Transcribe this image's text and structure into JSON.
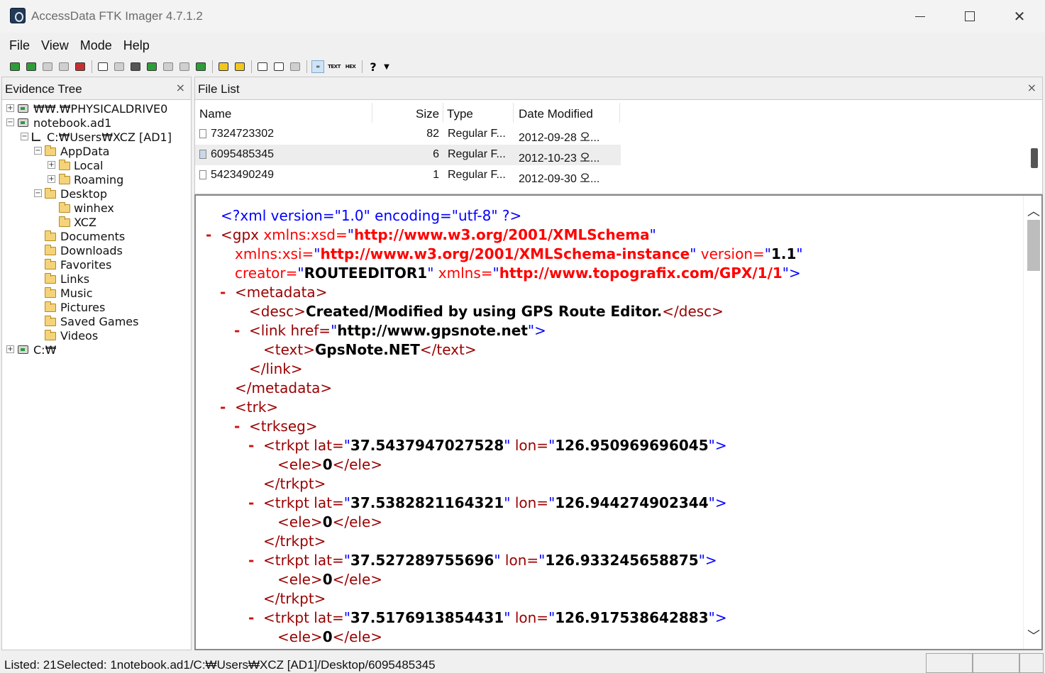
{
  "window": {
    "title": "AccessData FTK Imager 4.7.1.2"
  },
  "menu": [
    "File",
    "View",
    "Mode",
    "Help"
  ],
  "toolbar_icons": [
    "add-evidence-icon",
    "add-all-icon",
    "image-mounting-icon",
    "remove-evidence-icon",
    "remove-all-icon",
    "create-image-icon",
    "export-image-icon",
    "export-logical-icon",
    "export-files-icon",
    "export-hash-icon",
    "verify-drive-icon",
    "capture-memory-icon",
    "obtain-protected-files-icon",
    "detect-encryption-icon",
    "view-files-icon",
    "view-properties-icon",
    "view-report-icon",
    "auto-mode-icon",
    "text-mode-icon",
    "hex-mode-icon",
    "help-icon"
  ],
  "evidence_tree": {
    "title": "Evidence Tree",
    "close": "×",
    "items": [
      {
        "label": "₩₩.₩PHYSICALDRIVE0",
        "expander": "+"
      },
      {
        "label": "notebook.ad1",
        "expander": "−"
      },
      {
        "label": "C:₩Users₩XCZ [AD1]",
        "expander": "−"
      },
      {
        "label": "AppData",
        "expander": "−"
      },
      {
        "label": "Local",
        "expander": "+"
      },
      {
        "label": "Roaming",
        "expander": "+"
      },
      {
        "label": "Desktop",
        "expander": "−"
      },
      {
        "label": "winhex",
        "expander": ""
      },
      {
        "label": "XCZ",
        "expander": ""
      },
      {
        "label": "Documents",
        "expander": ""
      },
      {
        "label": "Downloads",
        "expander": ""
      },
      {
        "label": "Favorites",
        "expander": ""
      },
      {
        "label": "Links",
        "expander": ""
      },
      {
        "label": "Music",
        "expander": ""
      },
      {
        "label": "Pictures",
        "expander": ""
      },
      {
        "label": "Saved Games",
        "expander": ""
      },
      {
        "label": "Videos",
        "expander": ""
      },
      {
        "label": "C:₩",
        "expander": "+"
      }
    ]
  },
  "file_list": {
    "title": "File List",
    "close": "×",
    "columns": [
      "Name",
      "Size",
      "Type",
      "Date Modified"
    ],
    "rows": [
      {
        "name": "7324723302",
        "size": "82",
        "type": "Regular F...",
        "date": "2012-09-28 오..."
      },
      {
        "name": "6095485345",
        "size": "6",
        "type": "Regular F...",
        "date": "2012-10-23 오..."
      },
      {
        "name": "5423490249",
        "size": "1",
        "type": "Regular F...",
        "date": "2012-09-30 오..."
      }
    ]
  },
  "xml": {
    "minus": "-",
    "l1": {
      "pre": "<?xml version=\"1.0\" encoding=\"utf-8\" ?>"
    },
    "l2": {
      "open": "<gpx",
      "attr1": " xmlns:xsd=",
      "q": "\"",
      "v1": "http://www.w3.org/2001/XMLSchema"
    },
    "l3": {
      "attr2": "xmlns:xsi=",
      "v2": "http://www.w3.org/2001/XMLSchema-instance",
      "attr3": " version=",
      "v3": "1.1"
    },
    "l4": {
      "attr4": "creator=",
      "v4": "ROUTEEDITOR1",
      "attr5": " xmlns=",
      "v5": "http://www.topografix.com/GPX/1/1",
      "close": ">"
    },
    "metadata_open": "<metadata>",
    "desc_open": "<desc>",
    "desc_text": "Created/Modified by using GPS Route Editor.",
    "desc_close": "</desc>",
    "link_open": "<link href=",
    "link_href": "http://www.gpsnote.net",
    "gt": ">",
    "text_open": "<text>",
    "text_value": "GpsNote.NET",
    "text_close": "</text>",
    "link_close": "</link>",
    "metadata_close": "</metadata>",
    "trk_open": "<trk>",
    "trkseg_open": "<trkseg>",
    "trkpt_open": "<trkpt lat=",
    "lon_attr": " lon=",
    "ele_open": "<ele>",
    "ele_close": "</ele>",
    "trkpt_close": "</trkpt>",
    "trkpts": [
      {
        "lat": "37.5437947027528",
        "lon": "126.950969696045",
        "ele": "0"
      },
      {
        "lat": "37.5382821164321",
        "lon": "126.944274902344",
        "ele": "0"
      },
      {
        "lat": "37.527289755696",
        "lon": "126.933245658875",
        "ele": "0"
      },
      {
        "lat": "37.5176913854431",
        "lon": "126.917538642883",
        "ele": "0"
      }
    ]
  },
  "status": {
    "text": "Listed: 21Selected: 1notebook.ad1/C:₩Users₩XCZ [AD1]/Desktop/6095485345"
  }
}
